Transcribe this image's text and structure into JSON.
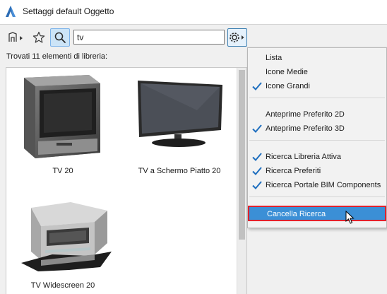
{
  "window": {
    "title": "Settaggi default Oggetto",
    "app_icon": "archicad-logo-icon"
  },
  "toolbar": {
    "library_manager_icon": "library-tree-icon",
    "favorites_icon": "star-icon",
    "search_icon": "search-icon",
    "search_value": "tv",
    "settings_icon": "gear-icon"
  },
  "results": {
    "found_label": "Trovati 11 elementi di libreria:",
    "items": [
      {
        "caption": "TV 20"
      },
      {
        "caption": "TV a Schermo Piatto 20"
      },
      {
        "caption": "TV Widescreen 20"
      }
    ]
  },
  "menu": {
    "items": [
      {
        "label": "Lista",
        "checked": false
      },
      {
        "label": "Icone Medie",
        "checked": false
      },
      {
        "label": "Icone Grandi",
        "checked": true
      },
      {
        "label": "Anteprime Preferito 2D",
        "checked": false
      },
      {
        "label": "Anteprime Preferito 3D",
        "checked": true
      },
      {
        "label": "Ricerca Libreria Attiva",
        "checked": true
      },
      {
        "label": "Ricerca Preferiti",
        "checked": true
      },
      {
        "label": "Ricerca Portale BIM Components",
        "checked": true
      },
      {
        "label": "Cancella Ricerca",
        "checked": false,
        "highlighted": true
      }
    ]
  },
  "colors": {
    "highlight": "#3b8fd6",
    "highlight_border": "#e0212d",
    "check": "#1f6fbf"
  }
}
